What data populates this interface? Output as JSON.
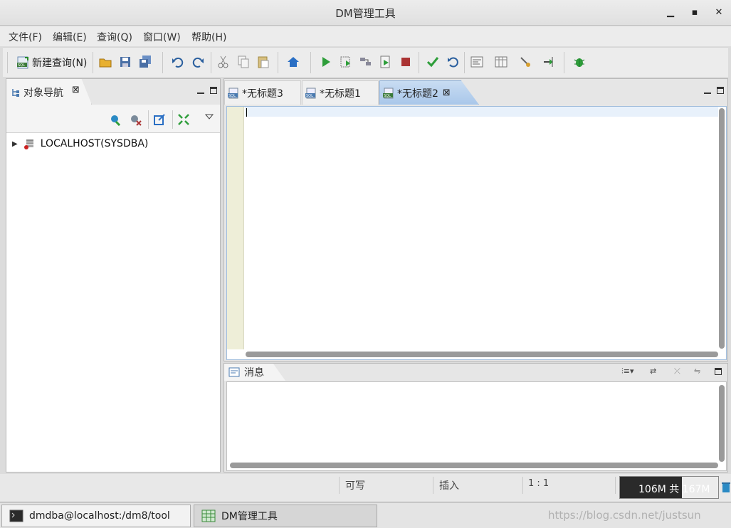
{
  "window": {
    "title": "DM管理工具"
  },
  "menu": [
    "文件(F)",
    "编辑(E)",
    "查询(Q)",
    "窗口(W)",
    "帮助(H)"
  ],
  "toolbar": {
    "new_query_label": "新建查询(N)"
  },
  "navigator": {
    "tab_label": "对象导航",
    "tree": [
      {
        "label": "LOCALHOST(SYSDBA)",
        "expanded": false
      }
    ]
  },
  "editor": {
    "tabs": [
      {
        "label": "*无标题3",
        "active": false
      },
      {
        "label": "*无标题1",
        "active": false
      },
      {
        "label": "*无标题2",
        "active": true
      }
    ],
    "content": ""
  },
  "messages": {
    "tab_label": "消息"
  },
  "status": {
    "mode": "可写",
    "insert": "插入",
    "position": "1 : 1",
    "heap": "106M 共 167M",
    "heap_used_fraction": 0.63
  },
  "taskbar": [
    {
      "label": "dmdba@localhost:/dm8/tool",
      "active": false
    },
    {
      "label": "DM管理工具",
      "active": true
    }
  ],
  "watermark": "https://blog.csdn.net/justsun",
  "colors": {
    "accent": "#a9c7ea",
    "run_green": "#2e9e3a",
    "stop_red": "#a33",
    "home_blue": "#2a6fc4"
  }
}
